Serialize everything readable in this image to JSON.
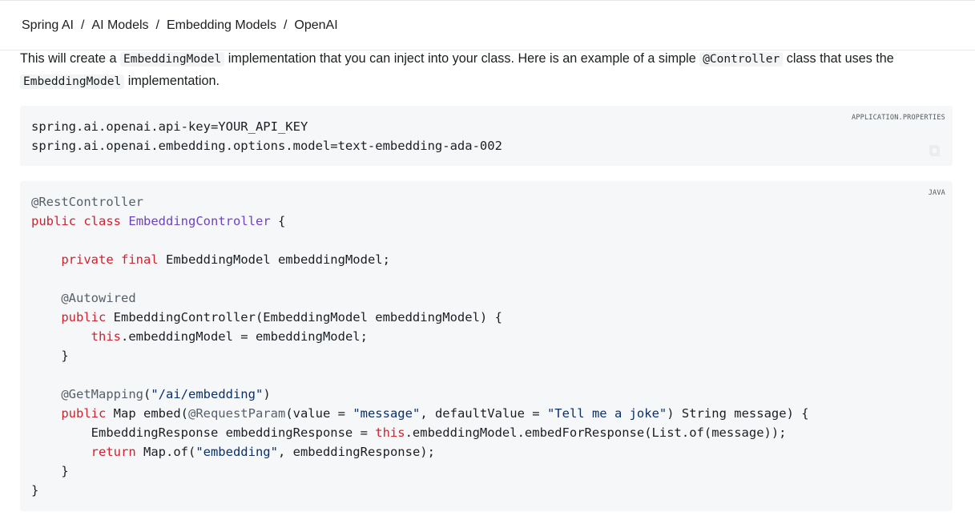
{
  "breadcrumb": [
    "Spring AI",
    "AI Models",
    "Embedding Models",
    "OpenAI"
  ],
  "breadcrumb_separator": "/",
  "intro": {
    "t1": "This will create a ",
    "c1": "EmbeddingModel",
    "t2": " implementation that you can inject into your class. Here is an example of a simple ",
    "c2": "@Controller",
    "t3": " class that uses the ",
    "c3": "EmbeddingModel",
    "t4": " implementation."
  },
  "code_properties": {
    "language": "APPLICATION.PROPERTIES",
    "lines": [
      "spring.ai.openai.api-key=YOUR_API_KEY",
      "spring.ai.openai.embedding.options.model=text-embedding-ada-002"
    ]
  },
  "code_java": {
    "language": "JAVA",
    "lines": [
      "@RestController",
      "public class EmbeddingController {",
      "",
      "    private final EmbeddingModel embeddingModel;",
      "",
      "    @Autowired",
      "    public EmbeddingController(EmbeddingModel embeddingModel) {",
      "        this.embeddingModel = embeddingModel;",
      "    }",
      "",
      "    @GetMapping(\"/ai/embedding\")",
      "    public Map embed(@RequestParam(value = \"message\", defaultValue = \"Tell me a joke\") String message) {",
      "        EmbeddingResponse embeddingResponse = this.embeddingModel.embedForResponse(List.of(message));",
      "        return Map.of(\"embedding\", embeddingResponse);",
      "    }",
      "}"
    ]
  },
  "colors": {
    "keyword": "#cf222e",
    "type": "#6f42c1",
    "annotation": "#57606a",
    "string": "#0a3069",
    "code_background": "#f6f7f8"
  }
}
